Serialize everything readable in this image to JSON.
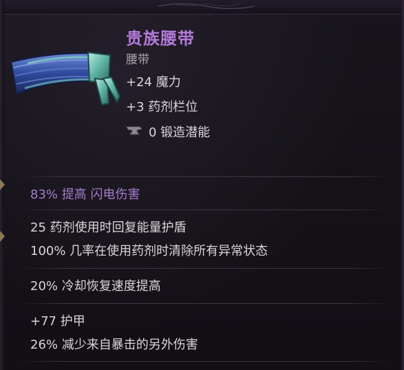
{
  "item": {
    "name": "贵族腰带",
    "type": "腰带",
    "base_stats": [
      "+24 魔力",
      "+3 药剂栏位"
    ],
    "forge": {
      "value": "0",
      "label": "锻造潜能",
      "icon": "anvil-icon"
    }
  },
  "enchant": "83% 提高 闪电伤害",
  "mod_groups": [
    [
      "25 药剂使用时回复能量护盾",
      "100% 几率在使用药剂时清除所有异常状态"
    ],
    [
      "20% 冷却恢复速度提高"
    ],
    [
      "+77 护甲",
      "26% 减少来自暴击的另外伤害"
    ]
  ],
  "colors": {
    "item_name": "#b27ad9",
    "enchant": "#a57ccf",
    "text": "#d9d6dc",
    "type_text": "#a9a6ac",
    "background": "#141217"
  }
}
